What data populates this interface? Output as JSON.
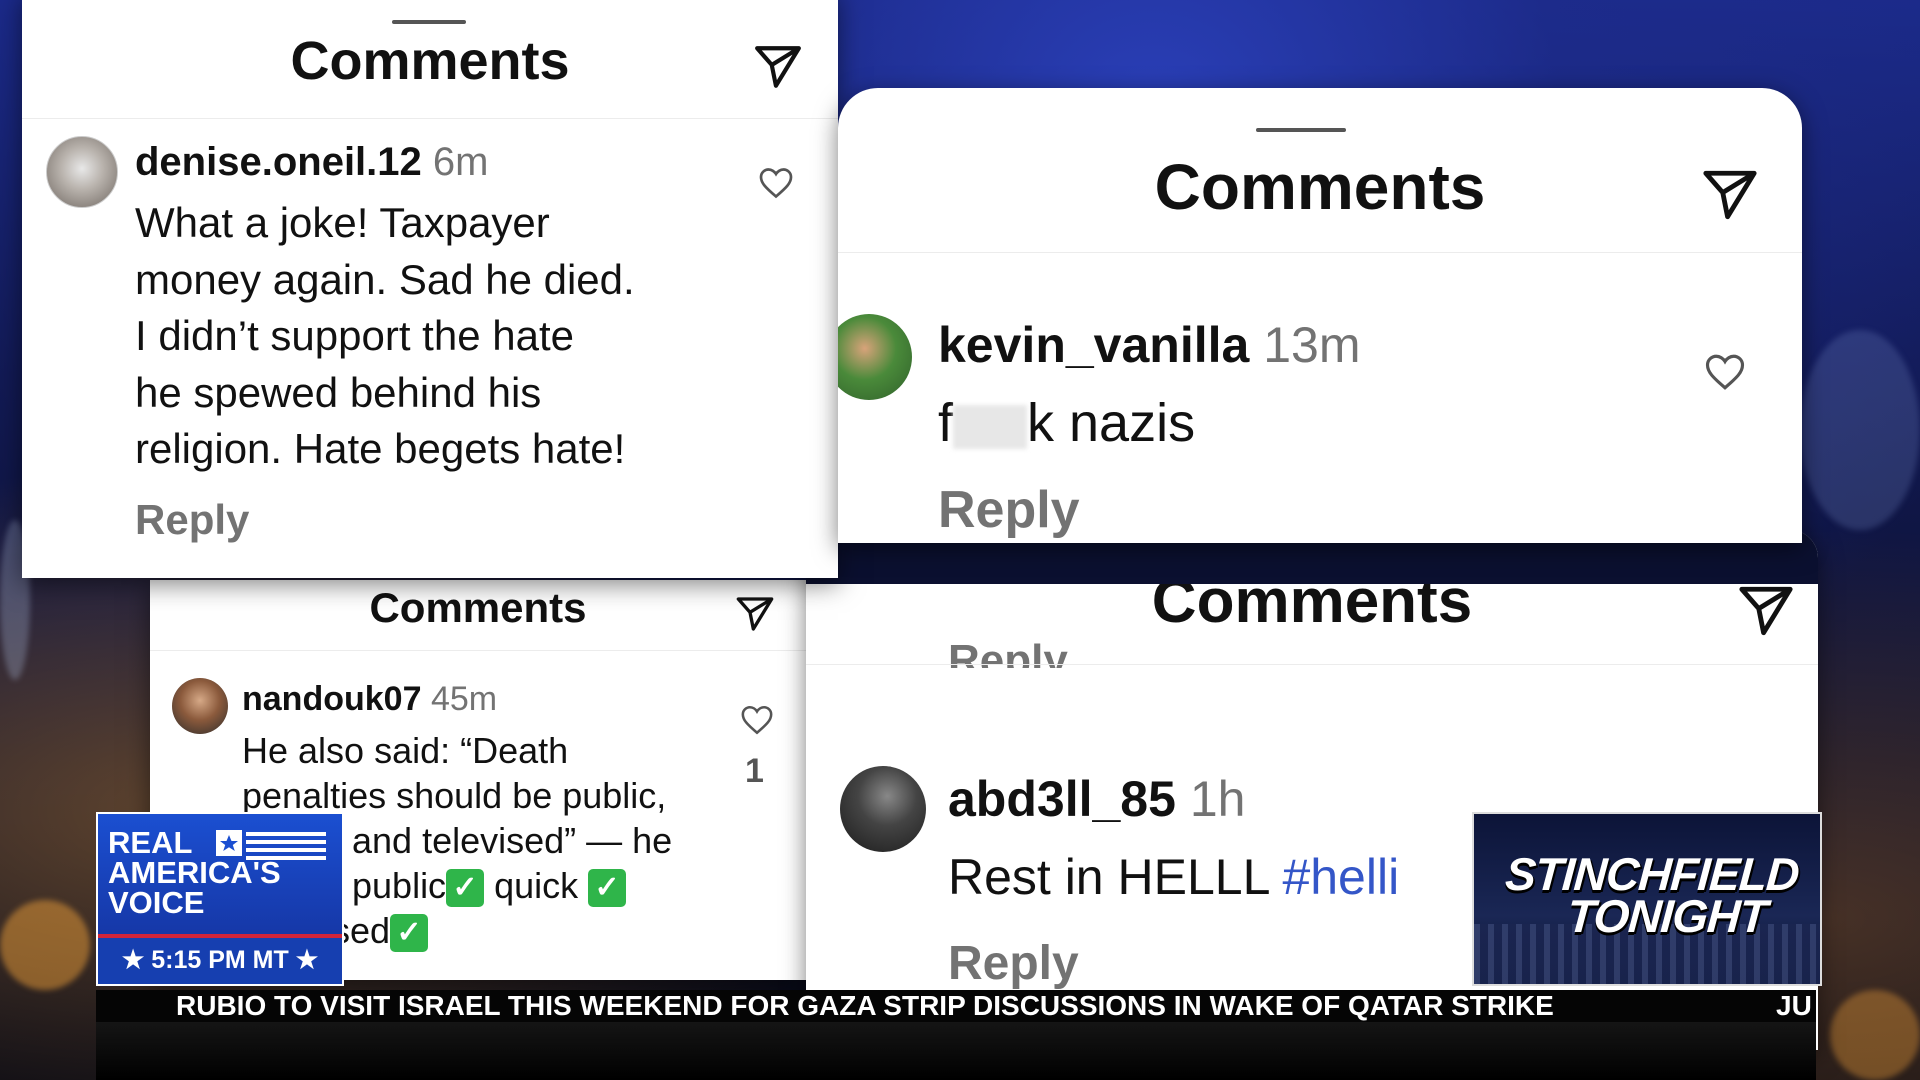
{
  "panels": [
    {
      "title": "Comments",
      "comment": {
        "username": "denise.oneil.12",
        "time": "6m",
        "lines": [
          "What a joke!  Taxpayer",
          "money again.  Sad he died.",
          "I didn’t support the hate",
          "he spewed behind his",
          "religion.  Hate begets hate!"
        ],
        "reply": "Reply"
      }
    },
    {
      "title": "Comments",
      "comment": {
        "username": "kevin_vanilla",
        "time": "13m",
        "text_start": "f",
        "text_end": "k nazis",
        "reply": "Reply"
      }
    },
    {
      "title": "Comments",
      "comment": {
        "username": "nandouk07",
        "time": "45m",
        "lines": [
          "He also said: “Death",
          "penalties should be public,",
          "and televised” — he",
          "public",
          " quick ",
          "sed"
        ],
        "like_count": "1"
      }
    },
    {
      "title": "Comments",
      "partial_reply": "Reply",
      "comment": {
        "username": "abd3ll_85",
        "time": "1h",
        "text": "Rest in HELLL ",
        "hashtag": "#helli",
        "reply": "Reply"
      }
    }
  ],
  "broadcast": {
    "network_logo": [
      "REAL",
      "AMERICA'S",
      "VOICE"
    ],
    "time": "5:15 PM MT",
    "show_logo": [
      "STINCHFIELD",
      "TONIGHT"
    ],
    "ticker": "RUBIO TO VISIT ISRAEL THIS WEEKEND FOR GAZA STRIP DISCUSSIONS IN WAKE OF QATAR STRIKE",
    "ticker_next": "JU"
  },
  "colors": {
    "hashtag": "#3456c8",
    "check": "#2fb54a",
    "network_blue": "#1b4fd1",
    "network_red": "#d2243a"
  }
}
